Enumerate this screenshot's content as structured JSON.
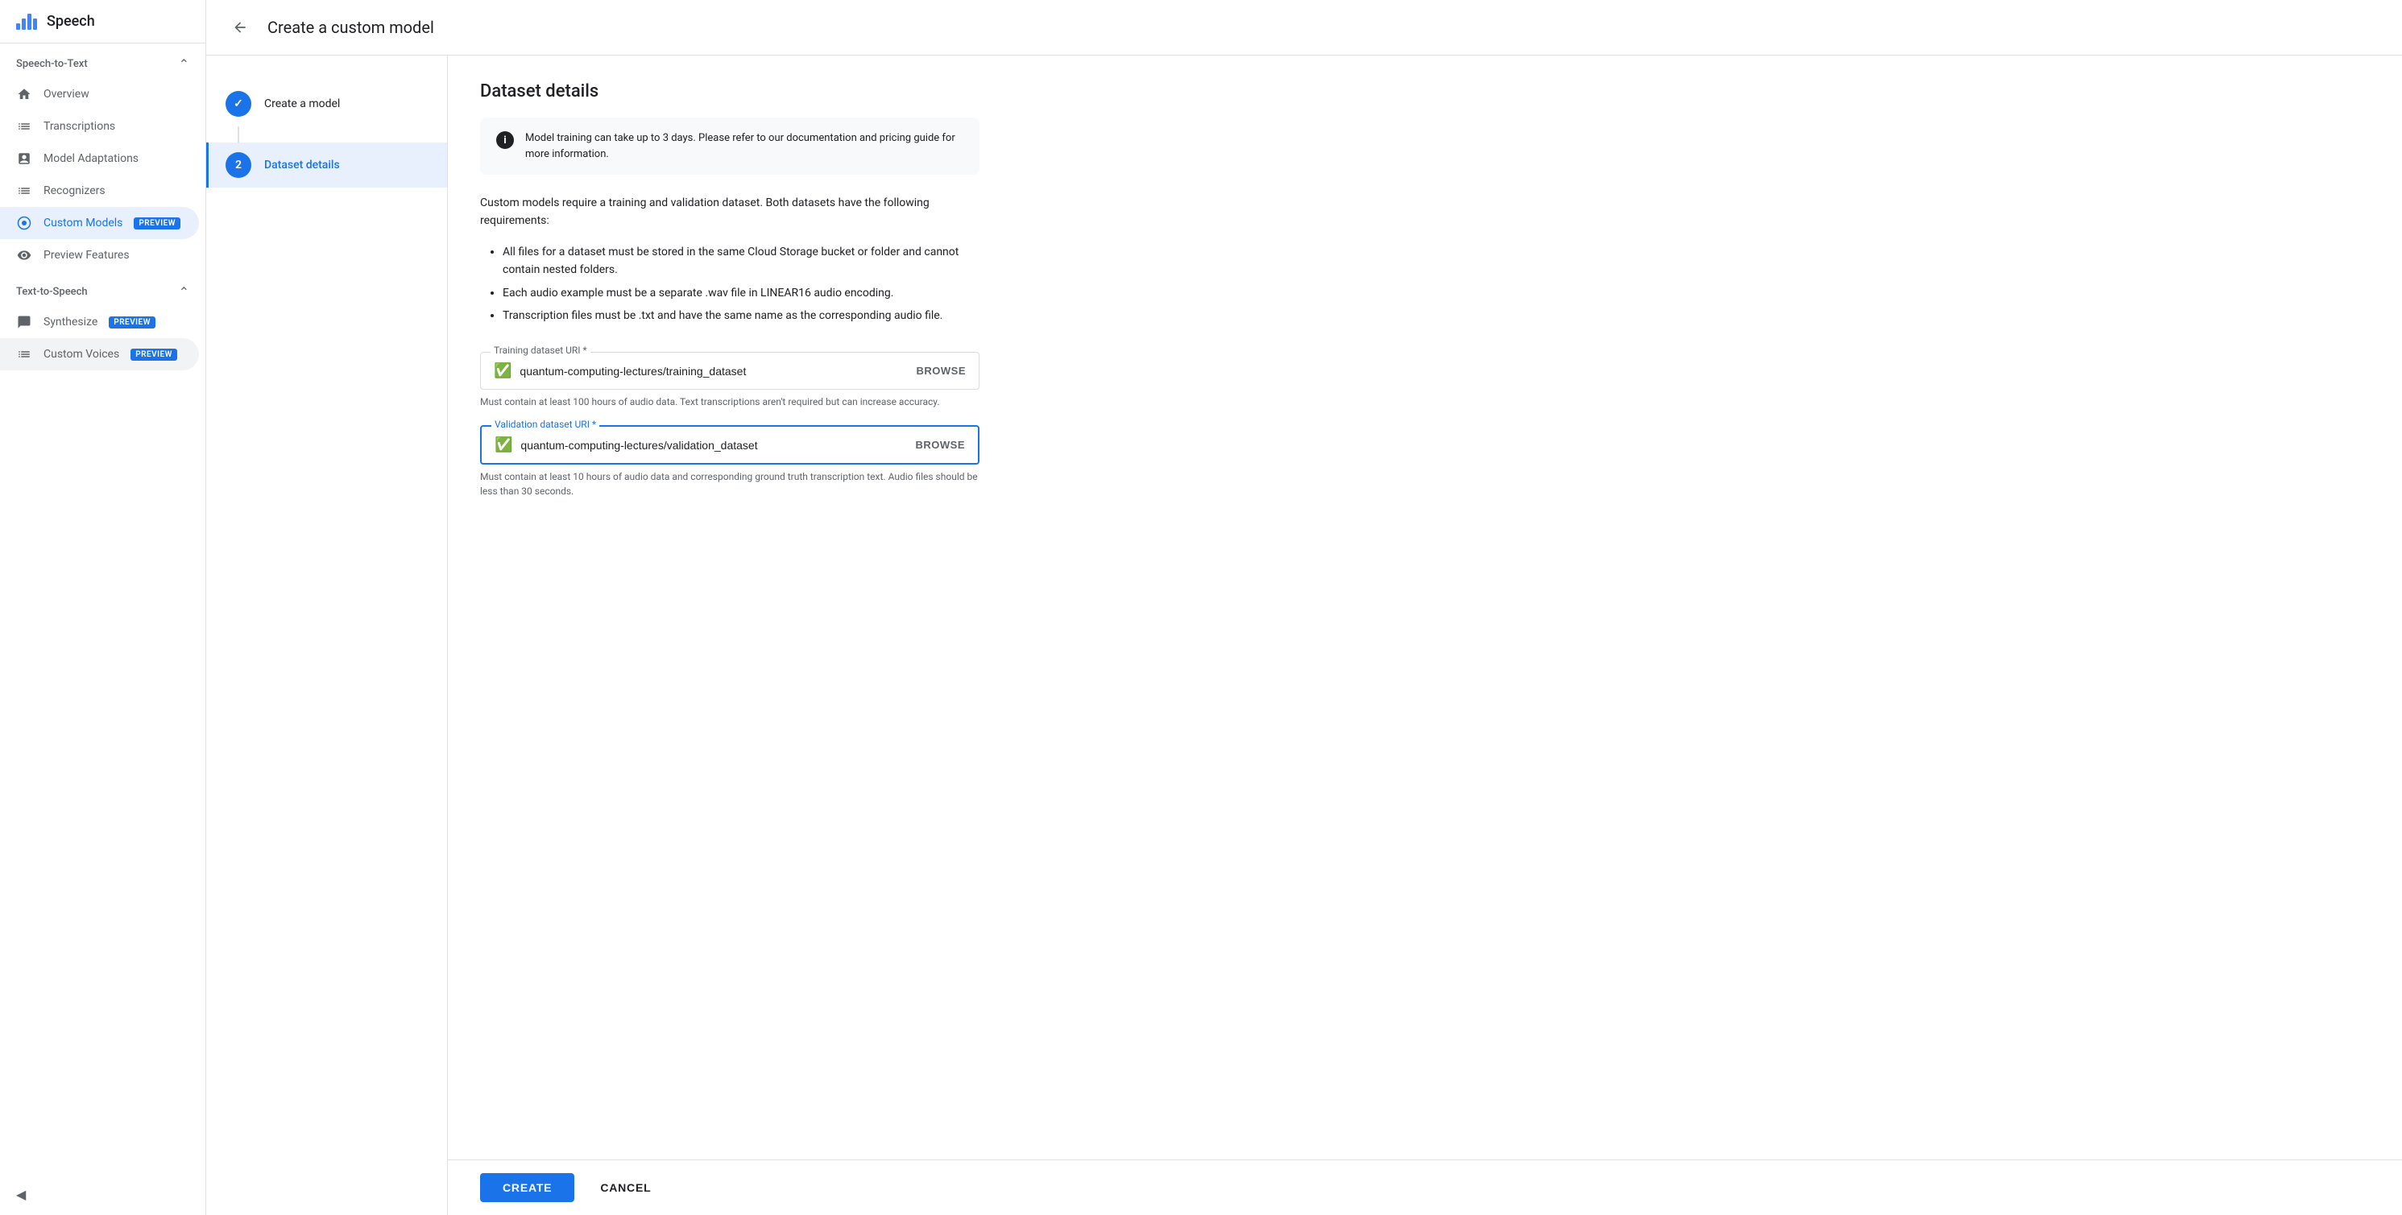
{
  "app": {
    "title": "Speech"
  },
  "sidebar": {
    "speech_to_text_label": "Speech-to-Text",
    "text_to_speech_label": "Text-to-Speech",
    "items_stt": [
      {
        "id": "overview",
        "label": "Overview",
        "icon": "home-icon"
      },
      {
        "id": "transcriptions",
        "label": "Transcriptions",
        "icon": "transcriptions-icon"
      },
      {
        "id": "model-adaptations",
        "label": "Model Adaptations",
        "icon": "model-adaptations-icon"
      },
      {
        "id": "recognizers",
        "label": "Recognizers",
        "icon": "recognizers-icon"
      },
      {
        "id": "custom-models",
        "label": "Custom Models",
        "icon": "custom-models-icon",
        "badge": "PREVIEW",
        "active": true
      }
    ],
    "preview_features": "Preview Features",
    "items_tts": [
      {
        "id": "synthesize",
        "label": "Synthesize",
        "icon": "synthesize-icon",
        "badge": "PREVIEW"
      },
      {
        "id": "custom-voices",
        "label": "Custom Voices",
        "icon": "custom-voices-icon",
        "badge": "PREVIEW",
        "active_bg": true
      }
    ],
    "collapse_icon": "◀"
  },
  "page": {
    "back_label": "←",
    "title": "Create a custom model"
  },
  "steps": [
    {
      "id": "create-model",
      "label": "Create a model",
      "state": "done",
      "number": "✓"
    },
    {
      "id": "dataset-details",
      "label": "Dataset details",
      "state": "active",
      "number": "2"
    }
  ],
  "dataset": {
    "title": "Dataset details",
    "info_text": "Model training can take up to 3 days. Please refer to our documentation and pricing guide for more information.",
    "description": "Custom models require a training and validation dataset. Both datasets have the following requirements:",
    "bullets": [
      "All files for a dataset must be stored in the same Cloud Storage bucket or folder and cannot contain nested folders.",
      "Each audio example must be a separate .wav file in LINEAR16 audio encoding.",
      "Transcription files must be .txt and have the same name as the corresponding audio file."
    ],
    "training_field": {
      "label": "Training dataset URI *",
      "value": "quantum-computing-lectures/training_dataset",
      "browse_label": "BROWSE",
      "hint": "Must contain at least 100 hours of audio data. Text transcriptions aren't required but can increase accuracy."
    },
    "validation_field": {
      "label": "Validation dataset URI *",
      "value": "quantum-computing-lectures/validation_dataset",
      "browse_label": "BROWSE",
      "hint": "Must contain at least 10 hours of audio data and corresponding ground truth transcription text. Audio files should be less than 30 seconds."
    }
  },
  "actions": {
    "create_label": "CREATE",
    "cancel_label": "CANCEL"
  }
}
